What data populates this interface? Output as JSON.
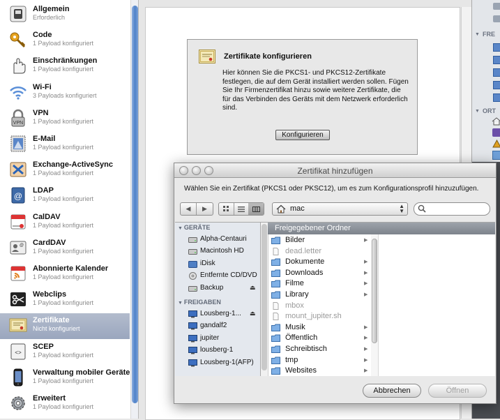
{
  "sidebar": {
    "items": [
      {
        "label": "Allgemein",
        "sub": "Erforderlich",
        "icon": "general-switch-icon"
      },
      {
        "label": "Code",
        "sub": "1 Payload konfiguriert",
        "icon": "key-icon"
      },
      {
        "label": "Einschränkungen",
        "sub": "1 Payload konfiguriert",
        "icon": "restrictions-hand-icon"
      },
      {
        "label": "Wi-Fi",
        "sub": "3 Payloads konfiguriert",
        "icon": "wifi-icon"
      },
      {
        "label": "VPN",
        "sub": "1 Payload konfiguriert",
        "icon": "vpn-lock-icon"
      },
      {
        "label": "E-Mail",
        "sub": "1 Payload konfiguriert",
        "icon": "mail-stamp-icon"
      },
      {
        "label": "Exchange-ActiveSync",
        "sub": "1 Payload konfiguriert",
        "icon": "exchange-icon"
      },
      {
        "label": "LDAP",
        "sub": "1 Payload konfiguriert",
        "icon": "ldap-address-book-icon"
      },
      {
        "label": "CalDAV",
        "sub": "1 Payload konfiguriert",
        "icon": "calendar-icon"
      },
      {
        "label": "CardDAV",
        "sub": "1 Payload konfiguriert",
        "icon": "contacts-card-icon"
      },
      {
        "label": "Abonnierte Kalender",
        "sub": "1 Payload konfiguriert",
        "icon": "subscribed-calendar-icon"
      },
      {
        "label": "Webclips",
        "sub": "1 Payload konfiguriert",
        "icon": "webclip-scissors-icon"
      },
      {
        "label": "Zertifikate",
        "sub": "Nicht konfiguriert",
        "icon": "certificate-icon",
        "selected": true
      },
      {
        "label": "SCEP",
        "sub": "1 Payload konfiguriert",
        "icon": "scep-icon"
      },
      {
        "label": "Verwaltung mobiler Geräte",
        "sub": "1 Payload konfiguriert",
        "icon": "mdm-phone-icon"
      },
      {
        "label": "Erweitert",
        "sub": "1 Payload konfiguriert",
        "icon": "advanced-gear-icon"
      }
    ]
  },
  "main": {
    "title": "Zertifikate konfigurieren",
    "description": "Hier können Sie die PKCS1- und PKCS12-Zertifikate festlegen, die auf dem Gerät installiert werden sollen. Fügen Sie Ihr Firmenzertifikat hinzu sowie weitere Zertifikate, die für das Verbinden des Geräts mit dem Netzwerk erforderlich sind.",
    "button": "Konfigurieren"
  },
  "finder_strip": {
    "section1": "FRE",
    "section2": "ORT"
  },
  "dialog": {
    "title": "Zertifikat hinzufügen",
    "prompt": "Wählen Sie ein Zertifikat (PKCS1 oder PKSC12), um es zum Konfigurationsprofil hinzuzufügen.",
    "location": "mac",
    "search_placeholder": "",
    "sidebar": {
      "devices_header": "GERÄTE",
      "devices": [
        {
          "label": "Alpha-Centauri",
          "icon": "hard-drive-icon"
        },
        {
          "label": "Macintosh HD",
          "icon": "hard-drive-icon"
        },
        {
          "label": "iDisk",
          "icon": "idisk-icon"
        },
        {
          "label": "Entfernte CD/DVD",
          "icon": "remote-disc-icon"
        },
        {
          "label": "Backup",
          "icon": "hard-drive-icon",
          "eject": true
        }
      ],
      "shared_header": "FREIGABEN",
      "shared": [
        {
          "label": "Lousberg-1...",
          "icon": "network-computer-icon",
          "eject": true
        },
        {
          "label": "gandalf2",
          "icon": "network-computer-icon"
        },
        {
          "label": "jupiter",
          "icon": "network-computer-icon"
        },
        {
          "label": "lousberg-1",
          "icon": "network-computer-icon"
        },
        {
          "label": "Lousberg-1(AFP)",
          "icon": "network-computer-icon"
        }
      ]
    },
    "column_header": "Freigegebener Ordner",
    "files": [
      {
        "name": "Bilder",
        "type": "folder",
        "enabled": true
      },
      {
        "name": "dead.letter",
        "type": "file",
        "enabled": false
      },
      {
        "name": "Dokumente",
        "type": "folder",
        "enabled": true
      },
      {
        "name": "Downloads",
        "type": "folder",
        "enabled": true
      },
      {
        "name": "Filme",
        "type": "folder",
        "enabled": true
      },
      {
        "name": "Library",
        "type": "folder",
        "enabled": true
      },
      {
        "name": "mbox",
        "type": "file",
        "enabled": false
      },
      {
        "name": "mount_jupiter.sh",
        "type": "file",
        "enabled": false
      },
      {
        "name": "Musik",
        "type": "folder",
        "enabled": true
      },
      {
        "name": "Öffentlich",
        "type": "folder",
        "enabled": true
      },
      {
        "name": "Schreibtisch",
        "type": "folder",
        "enabled": true
      },
      {
        "name": "tmp",
        "type": "folder",
        "enabled": true
      },
      {
        "name": "Websites",
        "type": "folder",
        "enabled": true
      }
    ],
    "cancel_label": "Abbrechen",
    "open_label": "Öffnen"
  },
  "colors": {
    "selection": "#9aa6be",
    "scroll_thumb": "#4f82c9",
    "column_header": "#8a9098",
    "folder_blue": "#6fa0d8"
  }
}
